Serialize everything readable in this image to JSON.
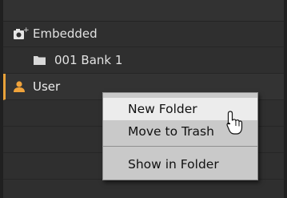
{
  "tree": {
    "items": [
      {
        "label": "Embedded",
        "icon": "camera-plus-icon"
      },
      {
        "label": "001 Bank 1",
        "icon": "folder-icon"
      },
      {
        "label": "User",
        "icon": "user-icon",
        "selected": true
      }
    ]
  },
  "context_menu": {
    "items": [
      {
        "label": "New Folder",
        "hovered": true
      },
      {
        "label": "Move to Trash"
      },
      {
        "label": "Show in Folder"
      }
    ]
  },
  "colors": {
    "selection_accent": "#e8a23a",
    "menu_background": "#c9c9c9"
  }
}
